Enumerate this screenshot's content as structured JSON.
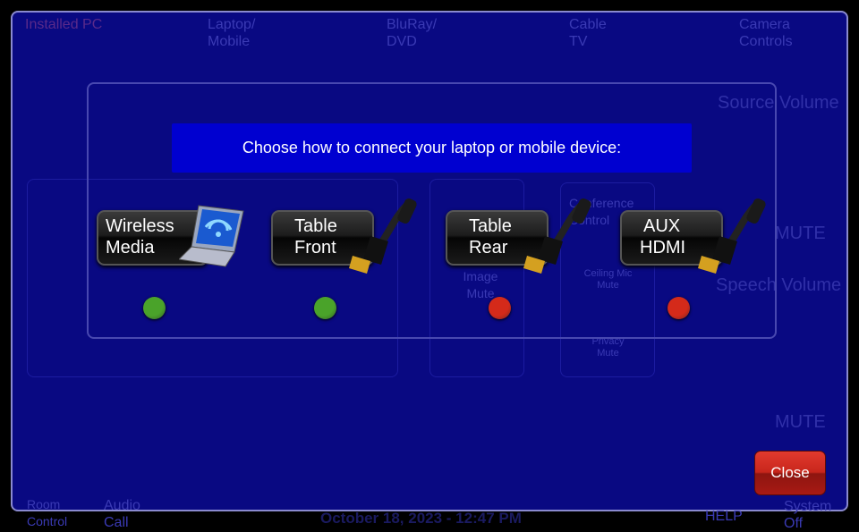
{
  "background": {
    "tabs": [
      "Installed PC",
      "Laptop/ Mobile",
      "BluRay/ DVD",
      "Cable TV",
      "Camera Controls"
    ],
    "source_volume": "Source Volume",
    "speech_volume": "Speech Volume",
    "mute": "MUTE",
    "image_mute": "Image Mute",
    "conference": "Conference Control",
    "ceiling_mic_mute": "Ceiling Mic Mute",
    "privacy_mute": "Privacy Mute",
    "room_control": "Room Control",
    "audio_call": "Audio Call",
    "datetime": "October 18, 2023  -  12:47 PM",
    "help": "HELP",
    "system_off": "System Off"
  },
  "dialog": {
    "title": "Choose how to connect your laptop or mobile device:",
    "sources": [
      {
        "line1": "Wireless",
        "line2": "Media",
        "icon": "laptop-wifi-icon",
        "status": "connected",
        "status_color": "#4aa32a"
      },
      {
        "line1": "Table",
        "line2": "Front",
        "icon": "hdmi-cable-icon",
        "status": "connected",
        "status_color": "#4aa32a"
      },
      {
        "line1": "Table",
        "line2": "Rear",
        "icon": "hdmi-cable-icon",
        "status": "disconnected",
        "status_color": "#d42a1a"
      },
      {
        "line1": "AUX",
        "line2": "HDMI",
        "icon": "hdmi-cable-icon",
        "status": "disconnected",
        "status_color": "#d42a1a"
      }
    ],
    "close_label": "Close"
  }
}
